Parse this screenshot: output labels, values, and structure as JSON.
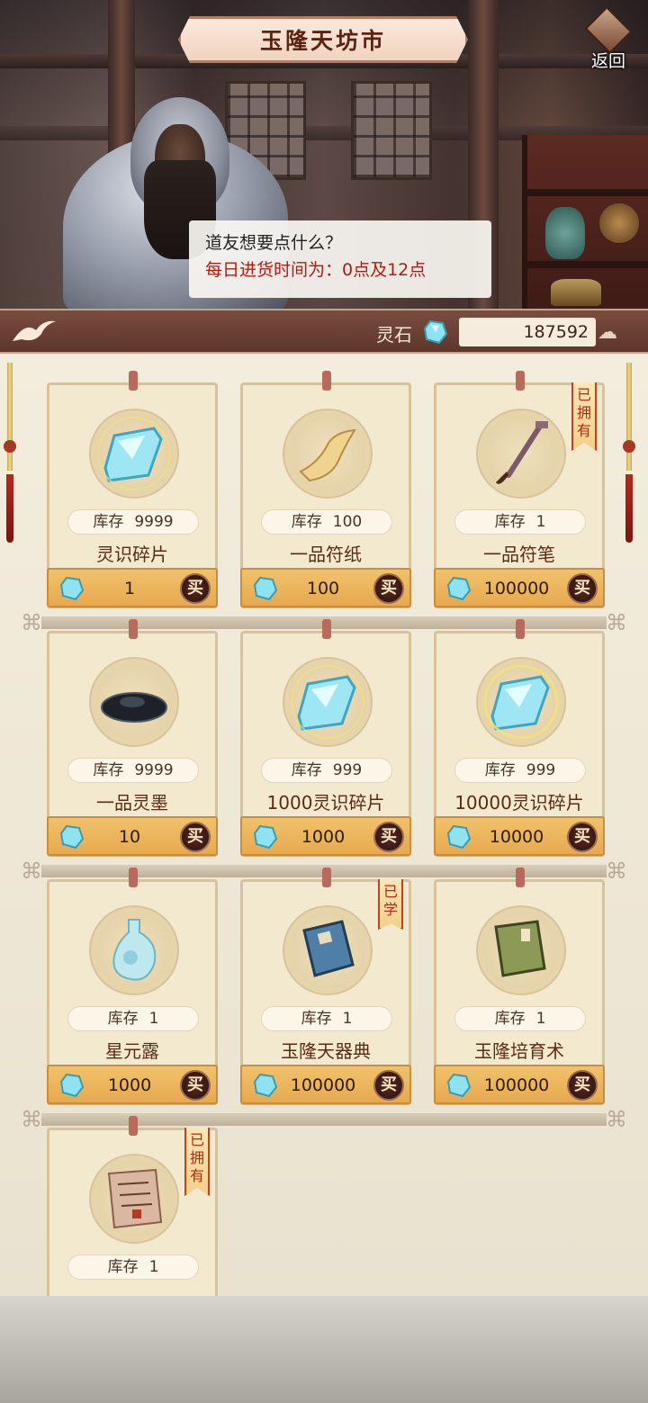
{
  "header": {
    "title": "玉隆天坊市",
    "back_label": "返回"
  },
  "npc": {
    "greeting": "道友想要点什么？",
    "restock_info": "每日进货时间为：0点及12点"
  },
  "currency": {
    "label": "灵石",
    "value": "187592",
    "icon": "spirit-stone-icon"
  },
  "shop": {
    "stock_label": "库存",
    "buy_label": "买",
    "items": [
      {
        "name": "灵识碎片",
        "stock": "9999",
        "price": "1",
        "icon": "crystal-shard-icon",
        "badge": ""
      },
      {
        "name": "一品符纸",
        "stock": "100",
        "price": "100",
        "icon": "talisman-paper-icon",
        "badge": ""
      },
      {
        "name": "一品符笔",
        "stock": "1",
        "price": "100000",
        "icon": "talisman-brush-icon",
        "badge": "已拥有"
      },
      {
        "name": "一品灵墨",
        "stock": "9999",
        "price": "10",
        "icon": "ink-stone-icon",
        "badge": ""
      },
      {
        "name": "1000灵识碎片",
        "stock": "999",
        "price": "1000",
        "icon": "crystal-shard-icon",
        "badge": ""
      },
      {
        "name": "10000灵识碎片",
        "stock": "999",
        "price": "10000",
        "icon": "crystal-shard-icon",
        "badge": ""
      },
      {
        "name": "星元露",
        "stock": "1",
        "price": "1000",
        "icon": "jade-bottle-icon",
        "badge": ""
      },
      {
        "name": "玉隆天器典",
        "stock": "1",
        "price": "100000",
        "icon": "blue-book-icon",
        "badge": "已学"
      },
      {
        "name": "玉隆培育术",
        "stock": "1",
        "price": "100000",
        "icon": "green-book-icon",
        "badge": ""
      },
      {
        "name": "",
        "stock": "1",
        "price": "",
        "icon": "scroll-parchment-icon",
        "badge": "已拥有"
      }
    ]
  },
  "colors": {
    "accent": "#5a2414",
    "price_bar": "#e7a94f",
    "badge_text": "#b2281a",
    "restock_text": "#b21a10"
  }
}
